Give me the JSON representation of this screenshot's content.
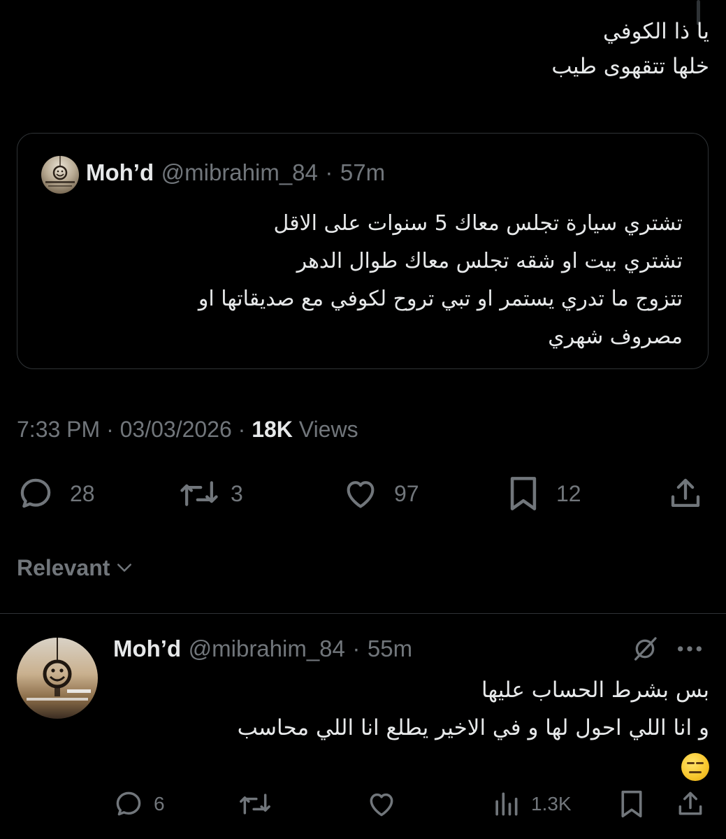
{
  "tweet": {
    "lines": [
      "يا ذا الكوفي",
      "خلها تتقهوى طيب"
    ]
  },
  "quote": {
    "name": "Moh’d",
    "handle": "@mibrahim_84",
    "separator": "·",
    "time": "57m",
    "lines": [
      "تشتري سيارة تجلس معاك 5 سنوات على الاقل",
      "تشتري بيت او شقه تجلس معاك طوال الدهر",
      "تتزوج ما تدري يستمر او تبي تروح لكوفي مع صديقاتها او",
      "مصروف شهري"
    ]
  },
  "meta": {
    "time": "7:33 PM",
    "separator": "·",
    "date": "03/03/2026",
    "views_count": "18K",
    "views_label": "Views"
  },
  "actions": {
    "replies": "28",
    "reposts": "3",
    "likes": "97",
    "bookmarks": "12"
  },
  "sort": {
    "label": "Relevant"
  },
  "reply": {
    "name": "Moh’d",
    "handle": "@mibrahim_84",
    "separator": "·",
    "time": "55m",
    "lines": [
      "بس بشرط الحساب عليها",
      "و انا اللي احول لها و في الاخير يطلع انا اللي محاسب"
    ],
    "emoji": "expressionless-face",
    "actions": {
      "replies": "6",
      "reposts": "",
      "likes": "",
      "views": "1.3K"
    }
  },
  "colors": {
    "background": "#000000",
    "text": "#e7e9ea",
    "muted": "#71767b",
    "border": "#2f3336"
  }
}
